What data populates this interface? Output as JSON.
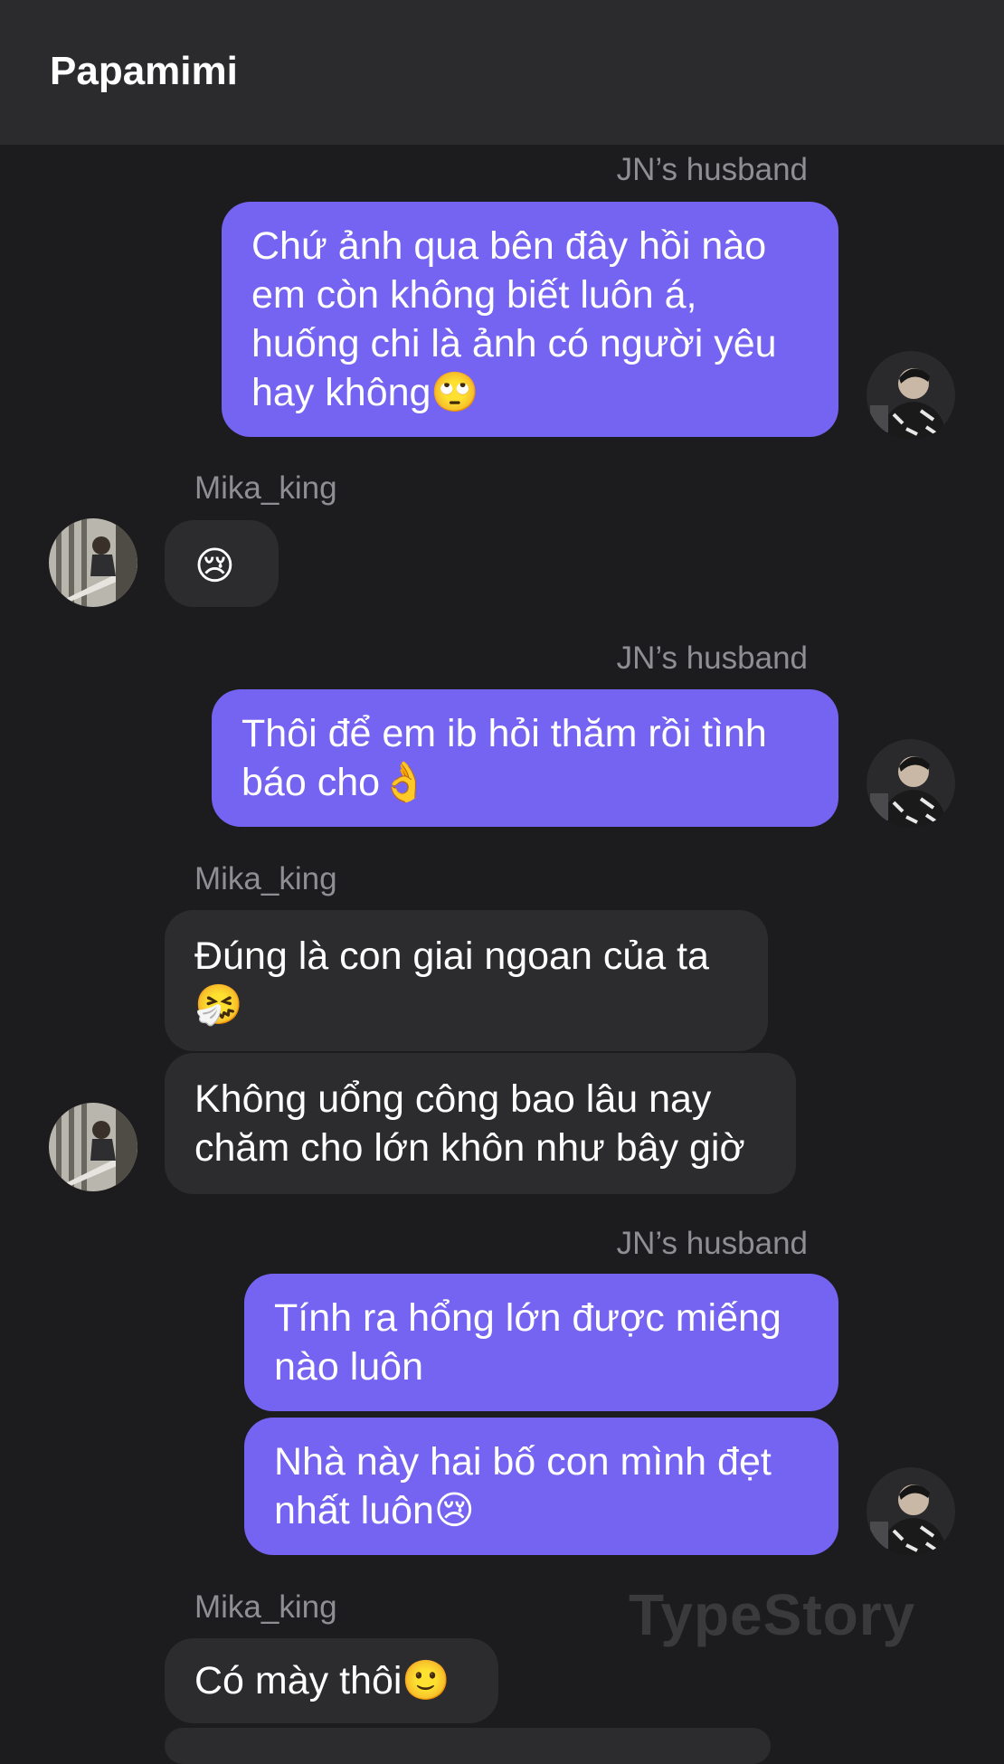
{
  "header": {
    "title": "Papamimi"
  },
  "watermark": "TypeStory",
  "senders": {
    "husband": "JN’s husband",
    "mika": "Mika_king"
  },
  "avatars": {
    "husband": "husband-avatar",
    "mika": "mika-avatar"
  },
  "messages": [
    {
      "sender": "JN’s husband",
      "text": "Chứ ảnh qua bên đây hồi nào em còn không biết luôn á, huống chi là ảnh có người yêu hay không🙄"
    },
    {
      "sender": "Mika_king",
      "text": "😢"
    },
    {
      "sender": "JN’s husband",
      "text": "Thôi để em ib hỏi thăm rồi tình báo cho👌"
    },
    {
      "sender": "Mika_king",
      "text": "Đúng là con giai ngoan của ta🤧"
    },
    {
      "sender": "Mika_king",
      "text": "Không uổng công bao lâu nay chăm cho lớn khôn như bây giờ"
    },
    {
      "sender": "JN’s husband",
      "text": "Tính ra hổng lớn được miếng nào luôn"
    },
    {
      "sender": "JN’s husband",
      "text": "Nhà này hai bố con mình đẹt nhất luôn😢"
    },
    {
      "sender": "Mika_king",
      "text": "Có mày thôi🙂"
    }
  ]
}
